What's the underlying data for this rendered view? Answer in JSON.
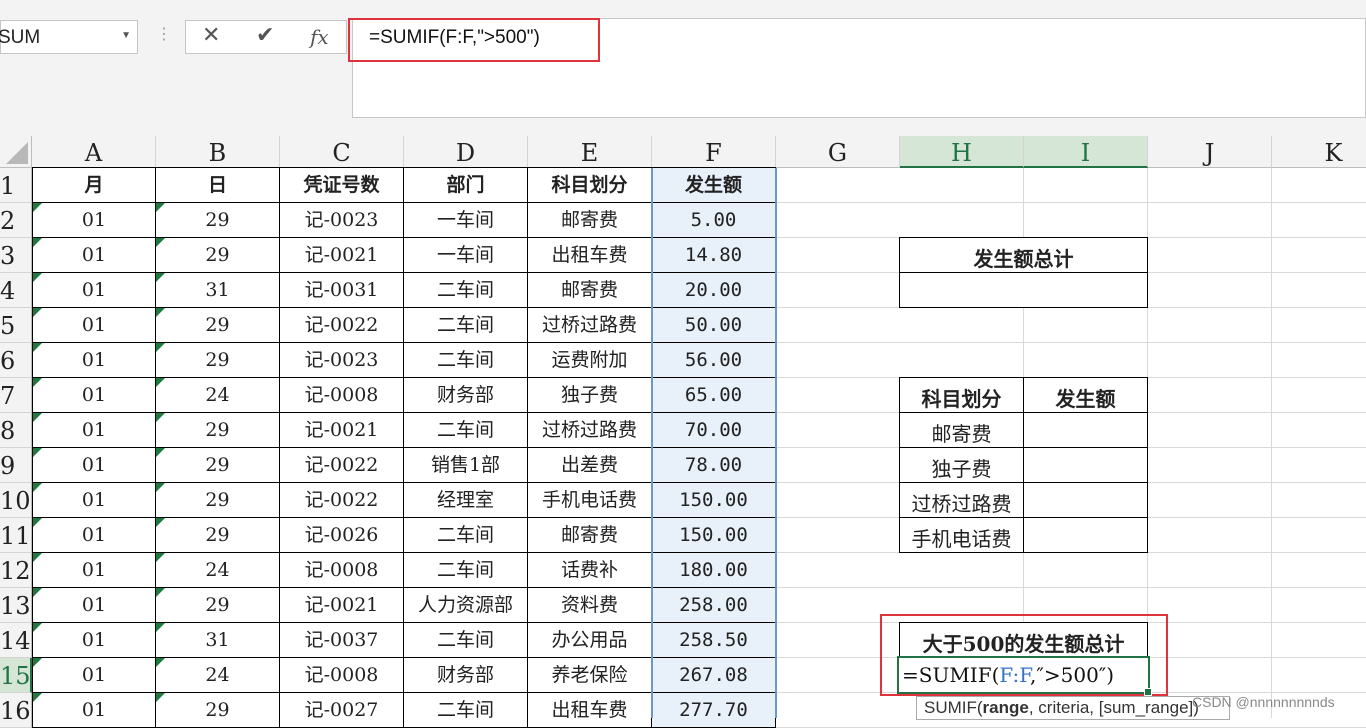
{
  "formula_bar": {
    "name_box": "SUM",
    "formula": "=SUMIF(F:F,\">500\")",
    "cancel_icon": "✕",
    "enter_icon": "✔",
    "fx_label": "fx"
  },
  "columns": [
    "A",
    "B",
    "C",
    "D",
    "E",
    "F",
    "G",
    "H",
    "I",
    "J",
    "K"
  ],
  "rows": [
    "1",
    "2",
    "3",
    "4",
    "5",
    "6",
    "7",
    "8",
    "9",
    "10",
    "11",
    "12",
    "13",
    "14",
    "15",
    "16"
  ],
  "table": {
    "headers": [
      "月",
      "日",
      "凭证号数",
      "部门",
      "科目划分",
      "发生额"
    ],
    "rows": [
      [
        "01",
        "29",
        "记-0023",
        "一车间",
        "邮寄费",
        "5.00"
      ],
      [
        "01",
        "29",
        "记-0021",
        "一车间",
        "出租车费",
        "14.80"
      ],
      [
        "01",
        "31",
        "记-0031",
        "二车间",
        "邮寄费",
        "20.00"
      ],
      [
        "01",
        "29",
        "记-0022",
        "二车间",
        "过桥过路费",
        "50.00"
      ],
      [
        "01",
        "29",
        "记-0023",
        "二车间",
        "运费附加",
        "56.00"
      ],
      [
        "01",
        "24",
        "记-0008",
        "财务部",
        "独子费",
        "65.00"
      ],
      [
        "01",
        "29",
        "记-0021",
        "二车间",
        "过桥过路费",
        "70.00"
      ],
      [
        "01",
        "29",
        "记-0022",
        "销售1部",
        "出差费",
        "78.00"
      ],
      [
        "01",
        "29",
        "记-0022",
        "经理室",
        "手机电话费",
        "150.00"
      ],
      [
        "01",
        "29",
        "记-0026",
        "二车间",
        "邮寄费",
        "150.00"
      ],
      [
        "01",
        "24",
        "记-0008",
        "二车间",
        "话费补",
        "180.00"
      ],
      [
        "01",
        "29",
        "记-0021",
        "人力资源部",
        "资料费",
        "258.00"
      ],
      [
        "01",
        "31",
        "记-0037",
        "二车间",
        "办公用品",
        "258.50"
      ],
      [
        "01",
        "24",
        "记-0008",
        "财务部",
        "养老保险",
        "267.08"
      ],
      [
        "01",
        "29",
        "记-0027",
        "二车间",
        "出租车费",
        "277.70"
      ]
    ]
  },
  "summary": {
    "total_title": "发生额总计",
    "category_header": "科目划分",
    "amount_header": "发生额",
    "categories": [
      "邮寄费",
      "独子费",
      "过桥过路费",
      "手机电话费"
    ],
    "over500_title": "大于500的发生额总计"
  },
  "active_cell": {
    "prefix": "=SUMIF(",
    "ref": "F:F",
    "suffix": ",″>500″)"
  },
  "tooltip": {
    "fn": "SUMIF(",
    "arg1": "range",
    "rest": ", criteria, [sum_range])"
  },
  "watermark": "CSDN @nnnnnnnnnds",
  "colors": {
    "accent_green": "#217346",
    "highlight_red": "#e0323b",
    "selected_column_fill": "#e8f0fa",
    "ref_blue": "#3573c7"
  }
}
